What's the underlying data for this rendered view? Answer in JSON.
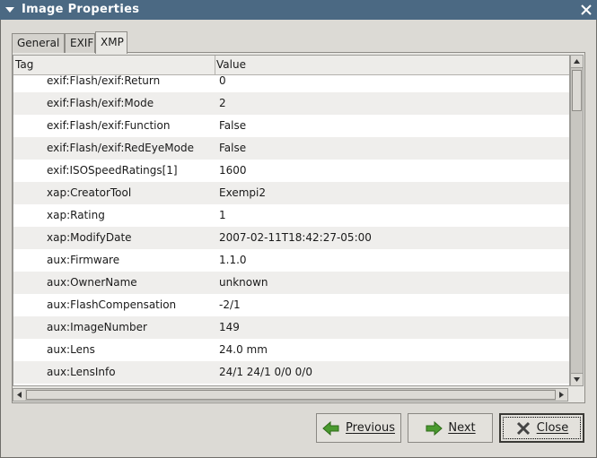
{
  "window": {
    "title": "Image Properties"
  },
  "tabs": [
    {
      "label": "General",
      "active": false
    },
    {
      "label": "EXIF",
      "active": false
    },
    {
      "label": "XMP",
      "active": true
    }
  ],
  "table": {
    "columns": [
      "Tag",
      "Value"
    ],
    "rows": [
      {
        "tag": "exif:Flash/exif:Return",
        "value": "0"
      },
      {
        "tag": "exif:Flash/exif:Mode",
        "value": "2"
      },
      {
        "tag": "exif:Flash/exif:Function",
        "value": "False"
      },
      {
        "tag": "exif:Flash/exif:RedEyeMode",
        "value": "False"
      },
      {
        "tag": "exif:ISOSpeedRatings[1]",
        "value": "1600"
      },
      {
        "tag": "xap:CreatorTool",
        "value": "Exempi2"
      },
      {
        "tag": "xap:Rating",
        "value": "1"
      },
      {
        "tag": "xap:ModifyDate",
        "value": "2007-02-11T18:42:27-05:00"
      },
      {
        "tag": "aux:Firmware",
        "value": "1.1.0"
      },
      {
        "tag": "aux:OwnerName",
        "value": "unknown"
      },
      {
        "tag": "aux:FlashCompensation",
        "value": "-2/1"
      },
      {
        "tag": "aux:ImageNumber",
        "value": "149"
      },
      {
        "tag": "aux:Lens",
        "value": "24.0 mm"
      },
      {
        "tag": "aux:LensInfo",
        "value": "24/1 24/1 0/0 0/0"
      }
    ]
  },
  "buttons": {
    "previous": "Previous",
    "next": "Next",
    "close": "Close"
  },
  "colors": {
    "titlebar": "#4b6983",
    "arrow_green": "#4a9a2f"
  }
}
